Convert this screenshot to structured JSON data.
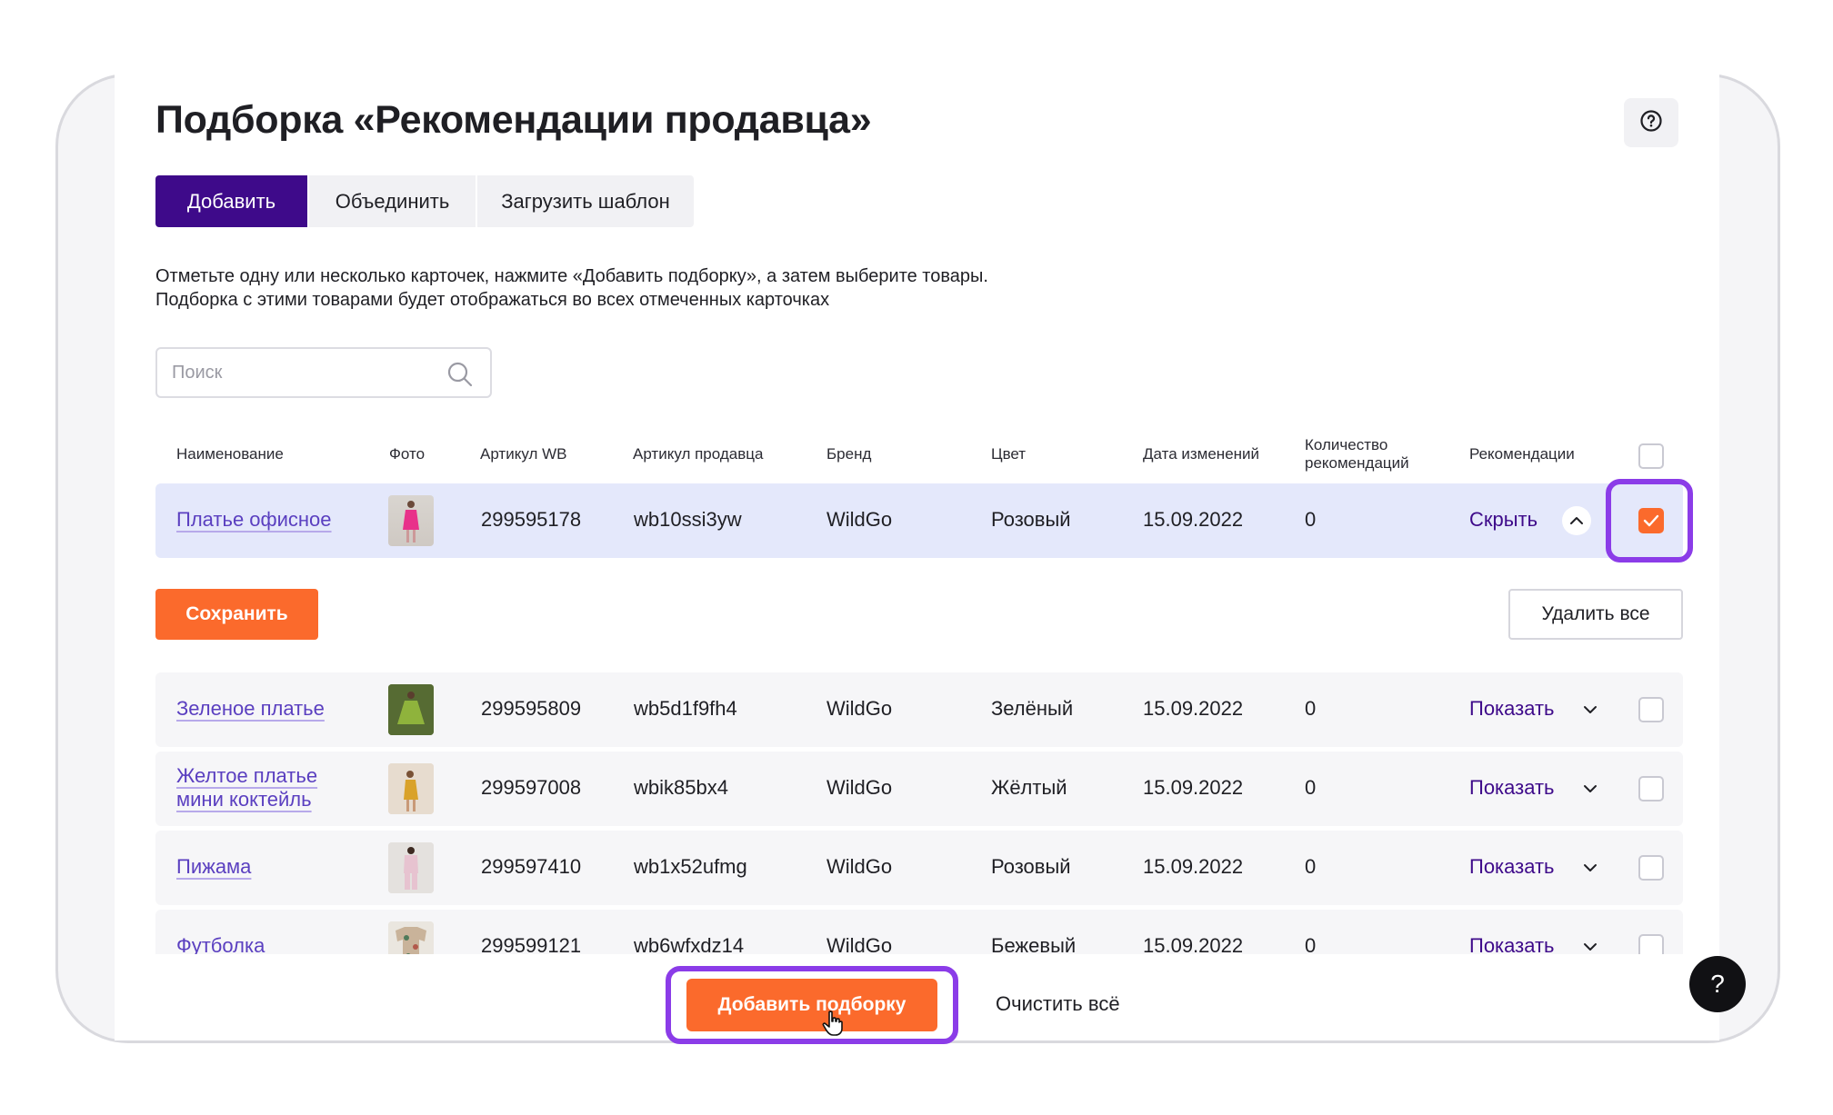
{
  "page": {
    "title": "Подборка «Рекомендации продавца»",
    "tabs": [
      "Добавить",
      "Объединить",
      "Загрузить шаблон"
    ],
    "description": "Отметьте одну или несколько карточек, нажмите «Добавить подборку», а затем выберите товары. Подборка с этими товарами будет отображаться во всех отмеченных карточках"
  },
  "search": {
    "placeholder": "Поиск"
  },
  "table": {
    "columns": [
      "Наименование",
      "Фото",
      "Артикул WB",
      "Артикул продавца",
      "Бренд",
      "Цвет",
      "Дата изменений",
      "Количество рекомендаций",
      "Рекомендации"
    ],
    "selected_row": {
      "name": "Платье офисное",
      "wb": "299595178",
      "seller": "wb10ssi3yw",
      "brand": "WildGo",
      "color": "Розовый",
      "date": "15.09.2022",
      "count": "0",
      "rec": "Скрыть",
      "checked": true
    },
    "rows": [
      {
        "name": "Зеленое платье",
        "wb": "299595809",
        "seller": "wb5d1f9fh4",
        "brand": "WildGo",
        "color": "Зелёный",
        "date": "15.09.2022",
        "count": "0",
        "rec": "Показать"
      },
      {
        "name": "Желтое платье мини коктейль",
        "wb": "299597008",
        "seller": "wbik85bx4",
        "brand": "WildGo",
        "color": "Жёлтый",
        "date": "15.09.2022",
        "count": "0",
        "rec": "Показать"
      },
      {
        "name": "Пижама",
        "wb": "299597410",
        "seller": "wb1x52ufmg",
        "brand": "WildGo",
        "color": "Розовый",
        "date": "15.09.2022",
        "count": "0",
        "rec": "Показать"
      },
      {
        "name": "Футболка",
        "wb": "299599121",
        "seller": "wb6wfxdz14",
        "brand": "WildGo",
        "color": "Бежевый",
        "date": "15.09.2022",
        "count": "0",
        "rec": "Показать"
      }
    ]
  },
  "buttons": {
    "save": "Сохранить",
    "delete_all": "Удалить все",
    "add_collection": "Добавить подборку",
    "clear_all": "Очистить всё",
    "help": "?"
  },
  "colors": {
    "primary": "#3e0a8a",
    "accent": "#fb6a2c",
    "highlight": "#8b3ce8",
    "selected_row": "#e4e8fb"
  },
  "icons": {
    "help": "question-circle-icon",
    "search": "magnifier-icon",
    "chevron_up": "chevron-up-icon",
    "chevron_down": "chevron-down-icon",
    "cursor": "hand-pointer-icon"
  }
}
